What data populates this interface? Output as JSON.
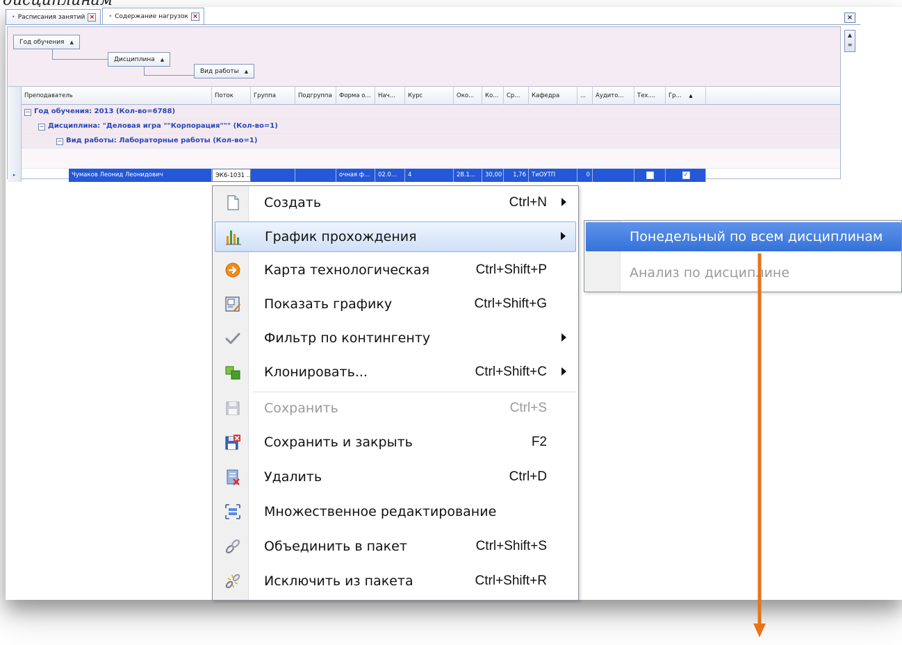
{
  "partial_title": "дисциплинам",
  "tabs": [
    {
      "label": "Расписания занятий",
      "active": false
    },
    {
      "label": "Содержание нагрузок",
      "active": true
    }
  ],
  "group_panel": {
    "chips": [
      {
        "label": "Год обучения"
      },
      {
        "label": "Дисциплина"
      },
      {
        "label": "Вид работы"
      }
    ]
  },
  "grid": {
    "columns": [
      "Преподаватель",
      "Поток",
      "Группа",
      "Подгруппа",
      "Форма о...",
      "Нач...",
      "Курс",
      "Око...",
      "Ко...",
      "Ср...",
      "Кафедра",
      "...",
      "Аудито...",
      "Тех....",
      "Гр..."
    ],
    "groups": [
      {
        "label": "Год обучения: 2013 (Кол-во=6788)"
      },
      {
        "label": "Дисциплина: \"Деловая игра \"\"Корпорация\"\"\" (Кол-во=1)"
      },
      {
        "label": "Вид работы: Лабораторные работы (Кол-во=1)"
      }
    ],
    "selected_row": {
      "teacher": "Чумаков Леонид Леонидович",
      "stream": "ЭК6-1031 ...",
      "form": "очная ф...",
      "start": "02.0...",
      "course": "4",
      "end": "28.1...",
      "count": "30,00",
      "avg": "1,76",
      "department": "ТиОУТП",
      "extra": "0"
    }
  },
  "context_menu": {
    "items": [
      {
        "label": "Создать",
        "shortcut": "Ctrl+N",
        "submenu": true,
        "icon": "new-document-icon",
        "disabled": false
      },
      {
        "label": "График прохождения",
        "shortcut": "",
        "submenu": true,
        "icon": "bar-chart-icon",
        "highlighted": true,
        "disabled": false
      },
      {
        "label": "Карта технологическая",
        "shortcut": "Ctrl+Shift+P",
        "submenu": false,
        "icon": "orange-circle-arrow-icon",
        "disabled": false
      },
      {
        "label": "Показать графику",
        "shortcut": "Ctrl+Shift+G",
        "submenu": false,
        "icon": "picture-icon",
        "disabled": false
      },
      {
        "label": "Фильтр по контингенту",
        "shortcut": "",
        "submenu": true,
        "icon": "checkmark-icon",
        "disabled": false
      },
      {
        "label": "Клонировать...",
        "shortcut": "Ctrl+Shift+C",
        "submenu": true,
        "icon": "green-cubes-icon",
        "disabled": false
      },
      {
        "label": "Сохранить",
        "shortcut": "Ctrl+S",
        "submenu": false,
        "icon": "floppy-disk-icon",
        "disabled": true
      },
      {
        "label": "Сохранить и закрыть",
        "shortcut": "F2",
        "submenu": false,
        "icon": "save-close-icon",
        "disabled": false
      },
      {
        "label": "Удалить",
        "shortcut": "Ctrl+D",
        "submenu": false,
        "icon": "delete-document-icon",
        "disabled": false
      },
      {
        "label": "Множественное редактирование",
        "shortcut": "",
        "submenu": false,
        "icon": "multi-edit-icon",
        "disabled": false
      },
      {
        "label": "Объединить в пакет",
        "shortcut": "Ctrl+Shift+S",
        "submenu": false,
        "icon": "chain-link-icon",
        "disabled": false
      },
      {
        "label": "Исключить из пакета",
        "shortcut": "Ctrl+Shift+R",
        "submenu": false,
        "icon": "broken-chain-icon",
        "disabled": false
      }
    ]
  },
  "submenu": {
    "items": [
      {
        "label": "Понедельный по всем дисциплинам",
        "highlighted": true,
        "disabled": false
      },
      {
        "label": "Анализ по дисциплине",
        "highlighted": false,
        "disabled": true
      }
    ]
  },
  "colors": {
    "accent": "#2458d8",
    "group_text": "#2a47b8",
    "annotation_arrow": "#e8731a"
  }
}
